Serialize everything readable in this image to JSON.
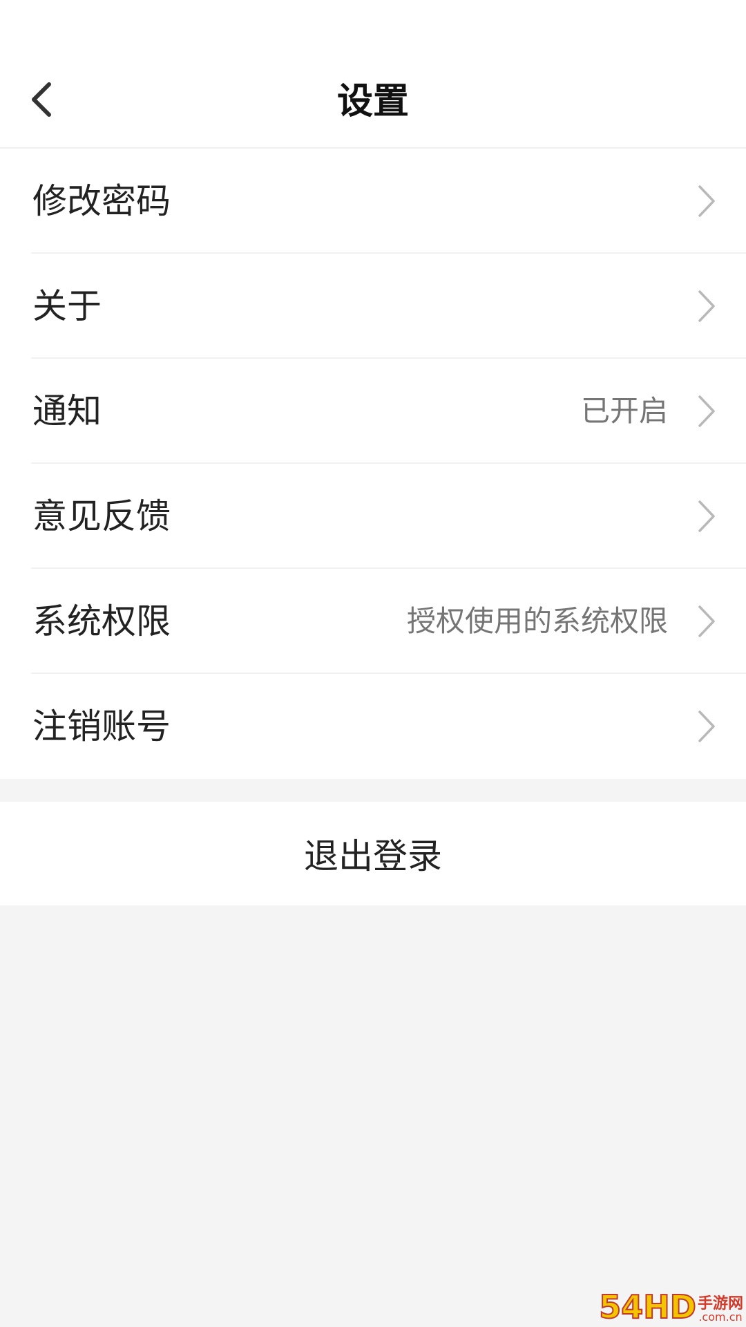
{
  "header": {
    "title": "设置",
    "back_icon": "chevron-left-icon"
  },
  "settings": {
    "items": [
      {
        "label": "修改密码",
        "value": ""
      },
      {
        "label": "关于",
        "value": ""
      },
      {
        "label": "通知",
        "value": "已开启"
      },
      {
        "label": "意见反馈",
        "value": ""
      },
      {
        "label": "系统权限",
        "value": "授权使用的系统权限"
      },
      {
        "label": "注销账号",
        "value": ""
      }
    ]
  },
  "logout": {
    "label": "退出登录"
  },
  "watermark": {
    "number": "54HD",
    "text": "手游网",
    "domain": ".com.cn"
  },
  "colors": {
    "background": "#f4f4f4",
    "surface": "#ffffff",
    "primary_text": "#222222",
    "secondary_text": "#757575",
    "chevron": "#b8b8b8"
  }
}
